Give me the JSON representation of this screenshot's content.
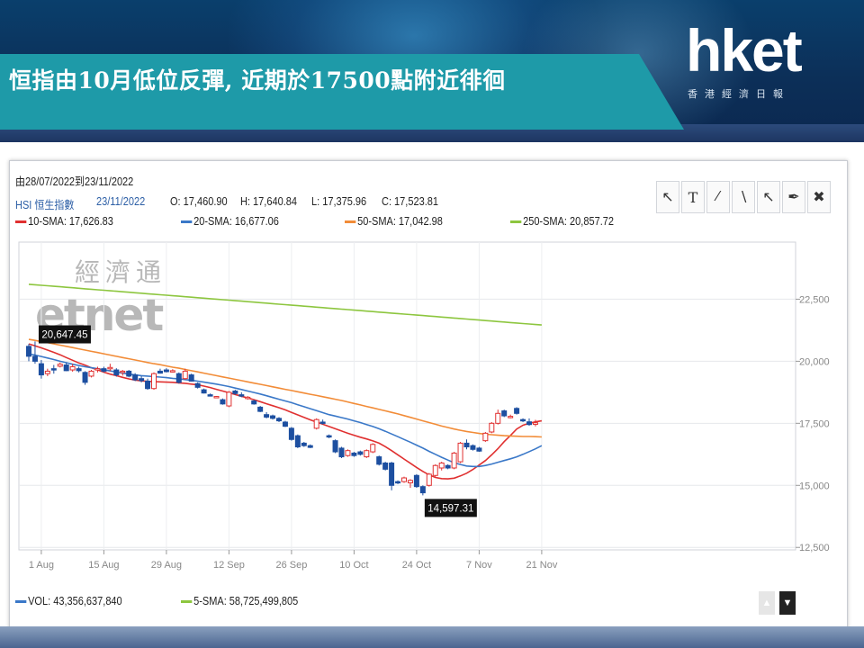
{
  "header": {
    "title": "恒指由10月低位反彈, 近期於17500點附近徘徊",
    "logo": "hket",
    "logo_sub": "香港經濟日報",
    "colors": {
      "background": "#0c2f58",
      "title_bar": "#1e9aa8"
    }
  },
  "chart_header": {
    "date_range": "由28/07/2022到23/11/2022",
    "symbol": "HSI 恒生指數",
    "date": "23/11/2022",
    "ohlc": {
      "open": "O: 17,460.90",
      "high": "H: 17,640.84",
      "low": "L: 17,375.96",
      "close": "C: 17,523.81"
    },
    "sma": [
      {
        "label": "10-SMA: 17,626.83",
        "color": "#e03030"
      },
      {
        "label": "20-SMA: 16,677.06",
        "color": "#3a78c8"
      },
      {
        "label": "50-SMA: 17,042.98",
        "color": "#f28c38"
      },
      {
        "label": "250-SMA: 20,857.72",
        "color": "#8dc63f"
      }
    ]
  },
  "toolbar": [
    {
      "name": "pointer-icon",
      "glyph": "↖"
    },
    {
      "name": "text-tool-icon",
      "glyph": "T"
    },
    {
      "name": "line-tool-icon",
      "glyph": "∕"
    },
    {
      "name": "parallel-lines-icon",
      "glyph": "∖"
    },
    {
      "name": "arrow-tool-icon",
      "glyph": "↖"
    },
    {
      "name": "eraser-icon",
      "glyph": "✒"
    },
    {
      "name": "trash-icon",
      "glyph": "✖"
    }
  ],
  "watermark": {
    "line1": "經濟通",
    "line2": "etnet"
  },
  "chart_data": {
    "type": "candlestick",
    "x_tick_labels": [
      "1 Aug",
      "15 Aug",
      "29 Aug",
      "12 Sep",
      "26 Sep",
      "10 Oct",
      "24 Oct",
      "7 Nov",
      "21 Nov"
    ],
    "y_ticks": [
      12500,
      15000,
      17500,
      20000,
      22500
    ],
    "y_tick_labels": [
      "12,500",
      "15,000",
      "17,500",
      "20,000",
      "22,500"
    ],
    "ylim": [
      12400,
      24800
    ],
    "annotations": [
      {
        "label": "20,647.45",
        "value": 20647.45,
        "index": 1
      },
      {
        "label": "14,597.31",
        "value": 14597.31,
        "index": 63
      }
    ],
    "up_color": "#e03030",
    "down_color": "#1d4fa0",
    "candles": [
      [
        20600,
        20700,
        20000,
        20200
      ],
      [
        20200,
        20800,
        19900,
        20000
      ],
      [
        19900,
        20050,
        19300,
        19450
      ],
      [
        19500,
        19700,
        19400,
        19600
      ],
      [
        19700,
        19850,
        19500,
        19650
      ],
      [
        19800,
        19950,
        19750,
        19880
      ],
      [
        19850,
        19950,
        19600,
        19620
      ],
      [
        19650,
        19900,
        19580,
        19780
      ],
      [
        19700,
        19780,
        19550,
        19620
      ],
      [
        19550,
        19600,
        19050,
        19150
      ],
      [
        19400,
        19650,
        19350,
        19600
      ],
      [
        19650,
        19780,
        19550,
        19700
      ],
      [
        19700,
        19780,
        19550,
        19600
      ],
      [
        19700,
        19900,
        19600,
        19750
      ],
      [
        19650,
        19720,
        19380,
        19450
      ],
      [
        19550,
        19650,
        19420,
        19600
      ],
      [
        19600,
        19650,
        19350,
        19400
      ],
      [
        19450,
        19520,
        19200,
        19250
      ],
      [
        19300,
        19400,
        19150,
        19220
      ],
      [
        19200,
        19300,
        18850,
        18900
      ],
      [
        18900,
        19550,
        18850,
        19500
      ],
      [
        19600,
        19700,
        19500,
        19520
      ],
      [
        19650,
        19720,
        19550,
        19580
      ],
      [
        19600,
        19680,
        19550,
        19620
      ],
      [
        19500,
        19550,
        19100,
        19150
      ],
      [
        19300,
        19700,
        19250,
        19600
      ],
      [
        19450,
        19500,
        19180,
        19200
      ],
      [
        19100,
        19150,
        18900,
        18950
      ],
      [
        18850,
        18900,
        18700,
        18720
      ],
      [
        18650,
        18700,
        18580,
        18620
      ],
      [
        18550,
        18600,
        18520,
        18580
      ],
      [
        18450,
        18500,
        18250,
        18280
      ],
      [
        18200,
        18800,
        18150,
        18750
      ],
      [
        18800,
        18850,
        18650,
        18700
      ],
      [
        18650,
        18750,
        18550,
        18600
      ],
      [
        18500,
        18600,
        18450,
        18550
      ],
      [
        18400,
        18450,
        18250,
        18280
      ],
      [
        18150,
        18200,
        17950,
        17980
      ],
      [
        17850,
        17950,
        17700,
        17750
      ],
      [
        17800,
        17850,
        17650,
        17700
      ],
      [
        17700,
        17750,
        17550,
        17600
      ],
      [
        17550,
        17600,
        17350,
        17380
      ],
      [
        17300,
        17350,
        16800,
        16850
      ],
      [
        17000,
        17050,
        16500,
        16550
      ],
      [
        16700,
        16750,
        16550,
        16600
      ],
      [
        16600,
        16650,
        16500,
        16530
      ],
      [
        17300,
        17700,
        17250,
        17650
      ],
      [
        17550,
        17650,
        17450,
        17500
      ],
      [
        17000,
        17050,
        16900,
        16950
      ],
      [
        16800,
        16850,
        16300,
        16350
      ],
      [
        16500,
        16550,
        16100,
        16150
      ],
      [
        16200,
        16450,
        16150,
        16400
      ],
      [
        16300,
        16350,
        16150,
        16200
      ],
      [
        16350,
        16400,
        16200,
        16250
      ],
      [
        16150,
        16450,
        16100,
        16400
      ],
      [
        16350,
        16700,
        16300,
        16650
      ],
      [
        16150,
        16200,
        15800,
        15850
      ],
      [
        15900,
        15950,
        15600,
        15650
      ],
      [
        15900,
        15950,
        14800,
        15000
      ],
      [
        15150,
        15200,
        15050,
        15100
      ],
      [
        15150,
        15350,
        15100,
        15300
      ],
      [
        15100,
        15250,
        14900,
        15200
      ],
      [
        15400,
        15450,
        14900,
        14950
      ],
      [
        14950,
        15000,
        14597,
        14700
      ],
      [
        15000,
        15500,
        14950,
        15450
      ],
      [
        15400,
        15850,
        15350,
        15800
      ],
      [
        15700,
        15950,
        15600,
        15900
      ],
      [
        15800,
        15850,
        15650,
        15700
      ],
      [
        15700,
        16350,
        15650,
        16300
      ],
      [
        15950,
        16750,
        15900,
        16700
      ],
      [
        16700,
        16850,
        16450,
        16550
      ],
      [
        16600,
        16650,
        16400,
        16450
      ],
      [
        16500,
        16550,
        16350,
        16380
      ],
      [
        16800,
        17150,
        16750,
        17100
      ],
      [
        17150,
        17550,
        17100,
        17500
      ],
      [
        17500,
        18050,
        17450,
        17900
      ],
      [
        18000,
        18050,
        17750,
        17800
      ],
      [
        17750,
        17850,
        17700,
        17780
      ],
      [
        18100,
        18150,
        17850,
        17900
      ],
      [
        17650,
        17700,
        17550,
        17620
      ],
      [
        17560,
        17700,
        17400,
        17450
      ],
      [
        17460,
        17640,
        17376,
        17523
      ]
    ],
    "series": [
      {
        "name": "10-SMA",
        "color": "#e03030",
        "values": [
          20700,
          20620,
          20540,
          20450,
          20360,
          20260,
          20150,
          20040,
          19930,
          19840,
          19740,
          19650,
          19560,
          19480,
          19420,
          19350,
          19290,
          19240,
          19210,
          19190,
          19180,
          19170,
          19160,
          19150,
          19130,
          19110,
          19080,
          19050,
          19000,
          18940,
          18870,
          18800,
          18730,
          18660,
          18590,
          18520,
          18450,
          18370,
          18290,
          18210,
          18130,
          18040,
          17940,
          17840,
          17740,
          17640,
          17550,
          17460,
          17370,
          17280,
          17190,
          17100,
          17020,
          16940,
          16870,
          16790,
          16700,
          16560,
          16400,
          16230,
          16060,
          15890,
          15720,
          15560,
          15420,
          15320,
          15270,
          15260,
          15290,
          15380,
          15490,
          15640,
          15820,
          16000,
          16230,
          16480,
          16760,
          17010,
          17270,
          17420,
          17500,
          17560,
          17600
        ]
      },
      {
        "name": "20-SMA",
        "color": "#3a78c8",
        "values": [
          20300,
          20250,
          20190,
          20130,
          20070,
          20000,
          19940,
          19880,
          19830,
          19780,
          19740,
          19700,
          19650,
          19610,
          19560,
          19520,
          19480,
          19450,
          19420,
          19400,
          19380,
          19360,
          19340,
          19310,
          19290,
          19260,
          19230,
          19200,
          19160,
          19120,
          19080,
          19030,
          18980,
          18920,
          18860,
          18800,
          18740,
          18680,
          18610,
          18540,
          18470,
          18400,
          18330,
          18250,
          18170,
          18090,
          18010,
          17930,
          17850,
          17790,
          17730,
          17670,
          17600,
          17530,
          17450,
          17370,
          17280,
          17180,
          17070,
          16960,
          16850,
          16740,
          16620,
          16500,
          16370,
          16250,
          16130,
          16020,
          15910,
          15840,
          15780,
          15760,
          15760,
          15800,
          15860,
          15930,
          16000,
          16070,
          16150,
          16250,
          16360,
          16470,
          16600
        ]
      },
      {
        "name": "50-SMA",
        "color": "#f28c38",
        "values": [
          20880,
          20840,
          20790,
          20750,
          20700,
          20650,
          20600,
          20550,
          20500,
          20450,
          20400,
          20350,
          20300,
          20250,
          20200,
          20150,
          20100,
          20050,
          20000,
          19950,
          19900,
          19860,
          19810,
          19760,
          19720,
          19670,
          19620,
          19570,
          19520,
          19470,
          19420,
          19370,
          19320,
          19270,
          19220,
          19170,
          19120,
          19070,
          19020,
          18970,
          18920,
          18870,
          18820,
          18770,
          18720,
          18670,
          18620,
          18570,
          18520,
          18470,
          18420,
          18360,
          18300,
          18240,
          18180,
          18120,
          18060,
          18000,
          17940,
          17880,
          17810,
          17740,
          17670,
          17600,
          17530,
          17460,
          17390,
          17330,
          17270,
          17220,
          17170,
          17130,
          17090,
          17060,
          17040,
          17020,
          17000,
          16990,
          16980,
          16970,
          16970,
          16960,
          16950
        ]
      },
      {
        "name": "250-SMA",
        "color": "#8dc63f",
        "values": [
          23100,
          23080,
          23060,
          23040,
          23020,
          23000,
          22980,
          22960,
          22940,
          22920,
          22900,
          22880,
          22860,
          22840,
          22820,
          22800,
          22780,
          22760,
          22740,
          22720,
          22700,
          22680,
          22660,
          22640,
          22620,
          22600,
          22580,
          22560,
          22540,
          22520,
          22500,
          22480,
          22460,
          22440,
          22420,
          22400,
          22380,
          22360,
          22340,
          22320,
          22300,
          22280,
          22260,
          22240,
          22220,
          22200,
          22180,
          22160,
          22140,
          22120,
          22100,
          22080,
          22060,
          22040,
          22020,
          22000,
          21980,
          21960,
          21940,
          21920,
          21900,
          21880,
          21860,
          21840,
          21820,
          21800,
          21780,
          21760,
          21740,
          21720,
          21700,
          21680,
          21660,
          21640,
          21620,
          21600,
          21580,
          21560,
          21540,
          21520,
          21500,
          21480,
          21460
        ]
      }
    ]
  },
  "volume_legend": {
    "vol": "VOL: 43,356,637,840",
    "vol_color": "#3a78c8",
    "sma5": "5-SMA: 58,725,499,805",
    "sma5_color": "#8dc63f"
  }
}
